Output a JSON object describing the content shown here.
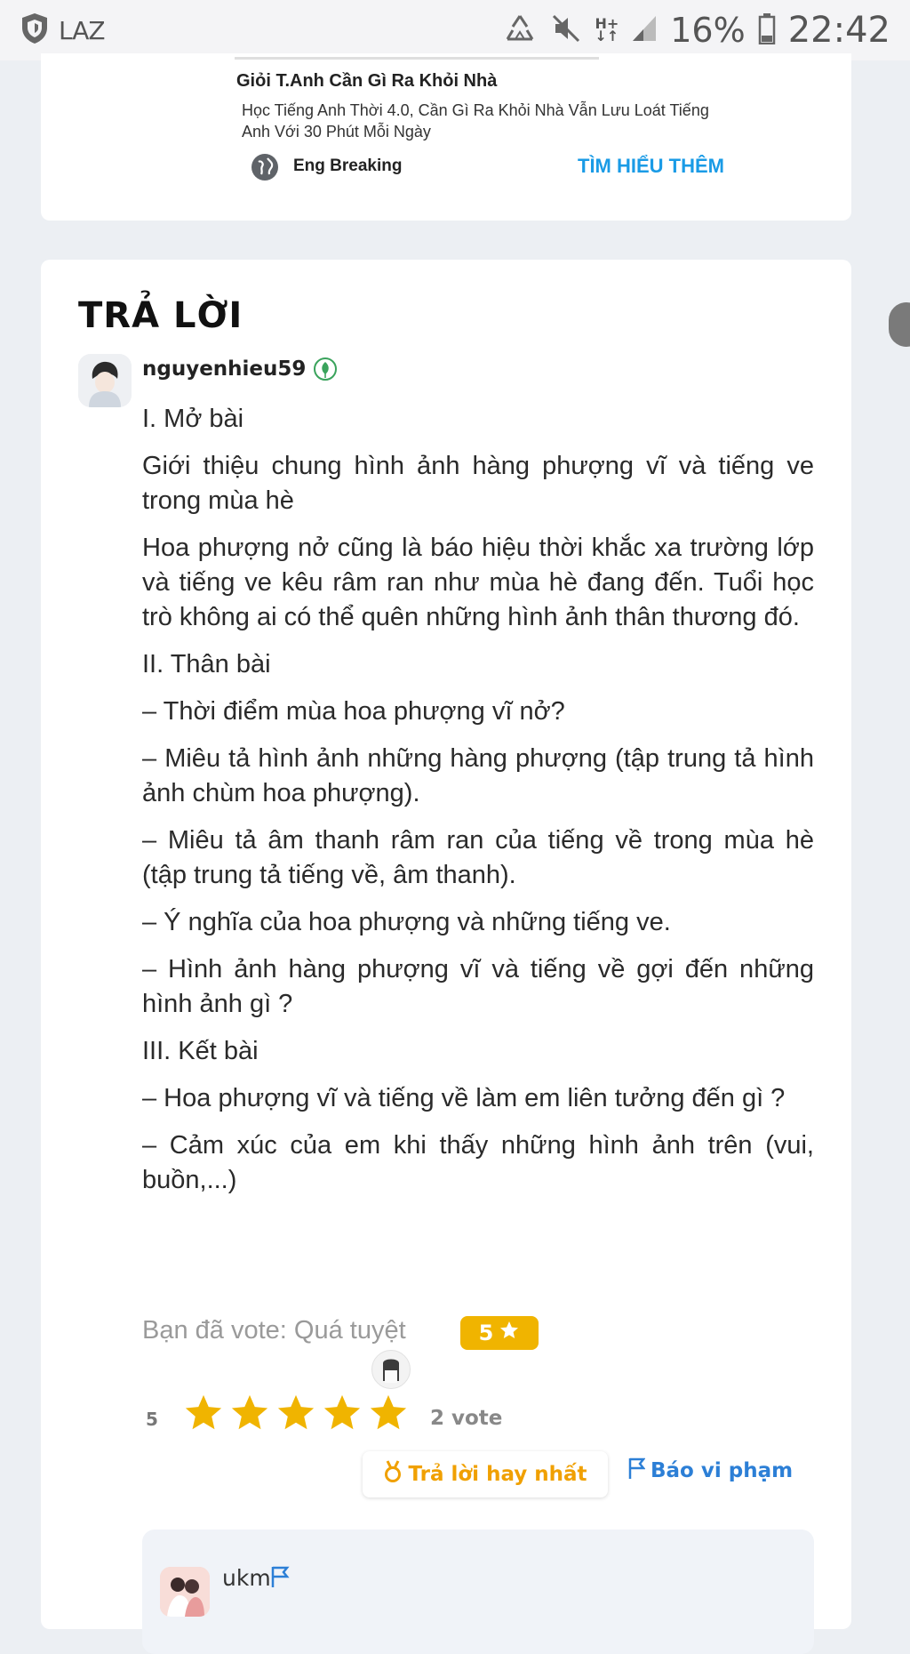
{
  "status_bar": {
    "carrier": "LAZ",
    "network": "H+",
    "battery": "16%",
    "time": "22:42"
  },
  "ad": {
    "title": "Giỏi T.Anh Cần Gì Ra Khỏi Nhà",
    "description": "Học Tiếng Anh Thời 4.0, Cần Gì Ra Khỏi Nhà Vẫn Lưu Loát Tiếng Anh Với 30 Phút Mỗi Ngày",
    "brand": "Eng Breaking",
    "cta": "TÌM HIỂU THÊM"
  },
  "answer": {
    "heading": "TRẢ LỜI",
    "username": "nguyenhieu59",
    "paragraphs": [
      "I. Mở bài",
      "Giới thiệu chung hình ảnh hàng phượng vĩ và tiếng ve trong mùa hè",
      "Hoa phượng nở cũng là báo hiệu thời khắc xa trường lớp và tiếng ve kêu râm ran như mùa hè đang đến. Tuổi học trò không ai có thể quên những hình ảnh thân thương đó.",
      "II. Thân bài",
      "– Thời điểm mùa hoa phượng vĩ nở?",
      "– Miêu tả hình ảnh những hàng phượng (tập trung tả hình ảnh chùm hoa phượng).",
      "– Miêu tả âm thanh râm ran của tiếng về trong mùa hè (tập trung tả tiếng về, âm thanh).",
      "– Ý nghĩa của hoa phượng và những tiếng ve.",
      "– Hình ảnh hàng phượng vĩ và tiếng về gợi đến những hình ảnh gì ?",
      "III. Kết bài",
      "– Hoa phượng vĩ và tiếng về làm em liên tưởng đến gì ?",
      "– Cảm xúc của em khi thấy những hình ảnh trên (vui, buồn,...)"
    ],
    "vote_status": "Bạn đã vote: Quá tuyệt",
    "vote_badge": "5",
    "rating": "5",
    "rating_value": 5,
    "vote_count": "2 vote",
    "best_answer_label": "Trả lời hay nhất",
    "report_label": "Báo vi phạm",
    "star_color": "#f0b400"
  },
  "comment": {
    "username": "ukm"
  }
}
